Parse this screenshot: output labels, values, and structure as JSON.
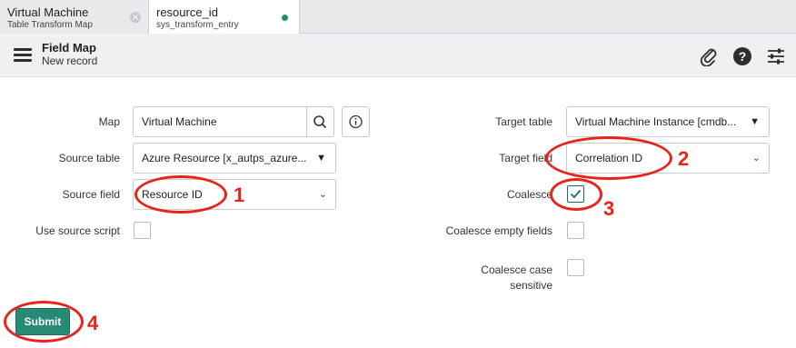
{
  "tabs": [
    {
      "title": "Virtual Machine",
      "subtitle": "Table Transform Map"
    },
    {
      "title": "resource_id",
      "subtitle": "sys_transform_entry"
    }
  ],
  "header": {
    "title": "Field Map",
    "subtitle": "New record"
  },
  "icons": {
    "menu": "hamburger-menu-icon",
    "attachment": "paperclip-icon",
    "help": "help-icon",
    "settings": "sliders-icon",
    "lookup": "search-icon",
    "info": "info-icon"
  },
  "form": {
    "map": {
      "label": "Map",
      "value": "Virtual Machine"
    },
    "source_table": {
      "label": "Source table",
      "value": "Azure Resource [x_autps_azure..."
    },
    "source_field": {
      "label": "Source field",
      "value": "Resource ID"
    },
    "use_source_script": {
      "label": "Use source script",
      "checked": false
    },
    "target_table": {
      "label": "Target table",
      "value": "Virtual Machine Instance [cmdb..."
    },
    "target_field": {
      "label": "Target field",
      "value": "Correlation ID"
    },
    "coalesce": {
      "label": "Coalesce",
      "checked": true
    },
    "coalesce_empty": {
      "label": "Coalesce empty fields",
      "checked": false
    },
    "coalesce_case_line1": "Coalesce case",
    "coalesce_case_line2": "sensitive",
    "coalesce_case_checked": false
  },
  "submit_label": "Submit",
  "annotations": [
    "1",
    "2",
    "3",
    "4"
  ],
  "colors": {
    "accent": "#278a77",
    "annotation": "#e5251b"
  }
}
